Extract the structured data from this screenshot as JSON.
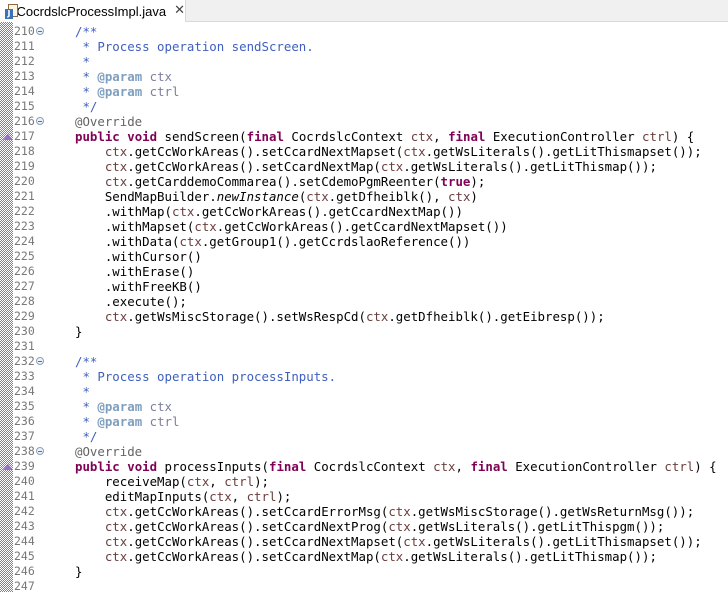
{
  "tab": {
    "file_icon": "java-file-icon",
    "title": "CocrdslcProcessImpl.java",
    "close_glyph": "✕"
  },
  "editor": {
    "lines": [
      {
        "n": "210",
        "fold": true,
        "override": false,
        "tokens": [
          [
            "jd",
            "/**"
          ]
        ]
      },
      {
        "n": "211",
        "fold": false,
        "override": false,
        "tokens": [
          [
            "jd",
            " * Process operation sendScreen."
          ]
        ]
      },
      {
        "n": "212",
        "fold": false,
        "override": false,
        "tokens": [
          [
            "jd",
            " *"
          ]
        ]
      },
      {
        "n": "213",
        "fold": false,
        "override": false,
        "tokens": [
          [
            "jd",
            " * "
          ],
          [
            "jdtag",
            "@param"
          ],
          [
            "jdp",
            " ctx"
          ]
        ]
      },
      {
        "n": "214",
        "fold": false,
        "override": false,
        "tokens": [
          [
            "jd",
            " * "
          ],
          [
            "jdtag",
            "@param"
          ],
          [
            "jdp",
            " ctrl"
          ]
        ]
      },
      {
        "n": "215",
        "fold": false,
        "override": false,
        "tokens": [
          [
            "jd",
            " */"
          ]
        ]
      },
      {
        "n": "216",
        "fold": true,
        "override": false,
        "tokens": [
          [
            "ann",
            "@Override"
          ]
        ]
      },
      {
        "n": "217",
        "fold": false,
        "override": true,
        "tokens": [
          [
            "kw",
            "public"
          ],
          [
            "",
            " "
          ],
          [
            "kw",
            "void"
          ],
          [
            "",
            " sendScreen("
          ],
          [
            "kw",
            "final"
          ],
          [
            "",
            " CocrdslcContext "
          ],
          [
            "par",
            "ctx"
          ],
          [
            "",
            ", "
          ],
          [
            "kw",
            "final"
          ],
          [
            "",
            " ExecutionController "
          ],
          [
            "par",
            "ctrl"
          ],
          [
            "",
            ") {"
          ]
        ]
      },
      {
        "n": "218",
        "fold": false,
        "override": false,
        "tokens": [
          [
            "",
            "    "
          ],
          [
            "par",
            "ctx"
          ],
          [
            "",
            ".getCcWorkAreas().setCcardNextMapset("
          ],
          [
            "par",
            "ctx"
          ],
          [
            "",
            ".getWsLiterals().getLitThismapset());"
          ]
        ]
      },
      {
        "n": "219",
        "fold": false,
        "override": false,
        "tokens": [
          [
            "",
            "    "
          ],
          [
            "par",
            "ctx"
          ],
          [
            "",
            ".getCcWorkAreas().setCcardNextMap("
          ],
          [
            "par",
            "ctx"
          ],
          [
            "",
            ".getWsLiterals().getLitThismap());"
          ]
        ]
      },
      {
        "n": "220",
        "fold": false,
        "override": false,
        "tokens": [
          [
            "",
            "    "
          ],
          [
            "par",
            "ctx"
          ],
          [
            "",
            ".getCarddemoCommarea().setCdemoPgmReenter("
          ],
          [
            "kw",
            "true"
          ],
          [
            "",
            ");"
          ]
        ]
      },
      {
        "n": "221",
        "fold": false,
        "override": false,
        "tokens": [
          [
            "",
            "    SendMapBuilder."
          ],
          [
            "it",
            "newInstance"
          ],
          [
            "",
            "("
          ],
          [
            "par",
            "ctx"
          ],
          [
            "",
            ".getDfheiblk(), "
          ],
          [
            "par",
            "ctx"
          ],
          [
            "",
            ")"
          ]
        ]
      },
      {
        "n": "222",
        "fold": false,
        "override": false,
        "tokens": [
          [
            "",
            "    .withMap("
          ],
          [
            "par",
            "ctx"
          ],
          [
            "",
            ".getCcWorkAreas().getCcardNextMap())"
          ]
        ]
      },
      {
        "n": "223",
        "fold": false,
        "override": false,
        "tokens": [
          [
            "",
            "    .withMapset("
          ],
          [
            "par",
            "ctx"
          ],
          [
            "",
            ".getCcWorkAreas().getCcardNextMapset())"
          ]
        ]
      },
      {
        "n": "224",
        "fold": false,
        "override": false,
        "tokens": [
          [
            "",
            "    .withData("
          ],
          [
            "par",
            "ctx"
          ],
          [
            "",
            ".getGroup1().getCcrdslaoReference())"
          ]
        ]
      },
      {
        "n": "225",
        "fold": false,
        "override": false,
        "tokens": [
          [
            "",
            "    .withCursor()"
          ]
        ]
      },
      {
        "n": "226",
        "fold": false,
        "override": false,
        "tokens": [
          [
            "",
            "    .withErase()"
          ]
        ]
      },
      {
        "n": "227",
        "fold": false,
        "override": false,
        "tokens": [
          [
            "",
            "    .withFreeKB()"
          ]
        ]
      },
      {
        "n": "228",
        "fold": false,
        "override": false,
        "tokens": [
          [
            "",
            "    .execute();"
          ]
        ]
      },
      {
        "n": "229",
        "fold": false,
        "override": false,
        "tokens": [
          [
            "",
            "    "
          ],
          [
            "par",
            "ctx"
          ],
          [
            "",
            ".getWsMiscStorage().setWsRespCd("
          ],
          [
            "par",
            "ctx"
          ],
          [
            "",
            ".getDfheiblk().getEibresp());"
          ]
        ]
      },
      {
        "n": "230",
        "fold": false,
        "override": false,
        "tokens": [
          [
            "",
            "}"
          ]
        ]
      },
      {
        "n": "231",
        "fold": false,
        "override": false,
        "tokens": []
      },
      {
        "n": "232",
        "fold": true,
        "override": false,
        "tokens": [
          [
            "jd",
            "/**"
          ]
        ]
      },
      {
        "n": "233",
        "fold": false,
        "override": false,
        "tokens": [
          [
            "jd",
            " * Process operation processInputs."
          ]
        ]
      },
      {
        "n": "234",
        "fold": false,
        "override": false,
        "tokens": [
          [
            "jd",
            " *"
          ]
        ]
      },
      {
        "n": "235",
        "fold": false,
        "override": false,
        "tokens": [
          [
            "jd",
            " * "
          ],
          [
            "jdtag",
            "@param"
          ],
          [
            "jdp",
            " ctx"
          ]
        ]
      },
      {
        "n": "236",
        "fold": false,
        "override": false,
        "tokens": [
          [
            "jd",
            " * "
          ],
          [
            "jdtag",
            "@param"
          ],
          [
            "jdp",
            " ctrl"
          ]
        ]
      },
      {
        "n": "237",
        "fold": false,
        "override": false,
        "tokens": [
          [
            "jd",
            " */"
          ]
        ]
      },
      {
        "n": "238",
        "fold": true,
        "override": false,
        "tokens": [
          [
            "ann",
            "@Override"
          ]
        ]
      },
      {
        "n": "239",
        "fold": false,
        "override": true,
        "tokens": [
          [
            "kw",
            "public"
          ],
          [
            "",
            " "
          ],
          [
            "kw",
            "void"
          ],
          [
            "",
            " processInputs("
          ],
          [
            "kw",
            "final"
          ],
          [
            "",
            " CocrdslcContext "
          ],
          [
            "par",
            "ctx"
          ],
          [
            "",
            ", "
          ],
          [
            "kw",
            "final"
          ],
          [
            "",
            " ExecutionController "
          ],
          [
            "par",
            "ctrl"
          ],
          [
            "",
            ") {"
          ]
        ]
      },
      {
        "n": "240",
        "fold": false,
        "override": false,
        "tokens": [
          [
            "",
            "    receiveMap("
          ],
          [
            "par",
            "ctx"
          ],
          [
            "",
            ", "
          ],
          [
            "par",
            "ctrl"
          ],
          [
            "",
            ");"
          ]
        ]
      },
      {
        "n": "241",
        "fold": false,
        "override": false,
        "tokens": [
          [
            "",
            "    editMapInputs("
          ],
          [
            "par",
            "ctx"
          ],
          [
            "",
            ", "
          ],
          [
            "par",
            "ctrl"
          ],
          [
            "",
            ");"
          ]
        ]
      },
      {
        "n": "242",
        "fold": false,
        "override": false,
        "tokens": [
          [
            "",
            "    "
          ],
          [
            "par",
            "ctx"
          ],
          [
            "",
            ".getCcWorkAreas().setCcardErrorMsg("
          ],
          [
            "par",
            "ctx"
          ],
          [
            "",
            ".getWsMiscStorage().getWsReturnMsg());"
          ]
        ]
      },
      {
        "n": "243",
        "fold": false,
        "override": false,
        "tokens": [
          [
            "",
            "    "
          ],
          [
            "par",
            "ctx"
          ],
          [
            "",
            ".getCcWorkAreas().setCcardNextProg("
          ],
          [
            "par",
            "ctx"
          ],
          [
            "",
            ".getWsLiterals().getLitThispgm());"
          ]
        ]
      },
      {
        "n": "244",
        "fold": false,
        "override": false,
        "tokens": [
          [
            "",
            "    "
          ],
          [
            "par",
            "ctx"
          ],
          [
            "",
            ".getCcWorkAreas().setCcardNextMapset("
          ],
          [
            "par",
            "ctx"
          ],
          [
            "",
            ".getWsLiterals().getLitThismapset());"
          ]
        ]
      },
      {
        "n": "245",
        "fold": false,
        "override": false,
        "tokens": [
          [
            "",
            "    "
          ],
          [
            "par",
            "ctx"
          ],
          [
            "",
            ".getCcWorkAreas().setCcardNextMap("
          ],
          [
            "par",
            "ctx"
          ],
          [
            "",
            ".getWsLiterals().getLitThismap());"
          ]
        ]
      },
      {
        "n": "246",
        "fold": false,
        "override": false,
        "tokens": [
          [
            "",
            "}"
          ]
        ]
      },
      {
        "n": "247",
        "fold": false,
        "override": false,
        "tokens": []
      }
    ]
  }
}
